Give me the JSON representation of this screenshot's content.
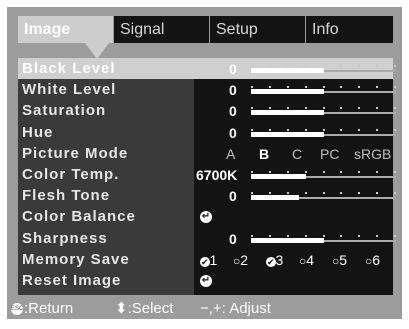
{
  "tabs": [
    {
      "label": "Image",
      "active": true
    },
    {
      "label": "Signal",
      "active": false
    },
    {
      "label": "Setup",
      "active": false
    },
    {
      "label": "Info",
      "active": false
    }
  ],
  "menu": {
    "rows": [
      {
        "label": "Black Level",
        "selected": true,
        "value": "0",
        "level": 0.5
      },
      {
        "label": "White Level",
        "value": "0",
        "level": 0.5
      },
      {
        "label": "Saturation",
        "value": "0",
        "level": 0.5
      },
      {
        "label": "Hue",
        "value": "0",
        "level": 0.5
      },
      {
        "label": "Picture Mode",
        "options": [
          "A",
          "B",
          "C",
          "PC",
          "sRGB"
        ],
        "selected_option": "B"
      },
      {
        "label": "Color Temp.",
        "value": "6700K",
        "level": 0.38
      },
      {
        "label": "Flesh Tone",
        "value": "0",
        "level": 0.33
      },
      {
        "label": "Color Balance",
        "icon": "enter-icon"
      },
      {
        "label": "Sharpness",
        "value": "0",
        "level": 0.5
      },
      {
        "label": "Memory Save",
        "slots": [
          "1",
          "2",
          "3",
          "4",
          "5",
          "6"
        ],
        "saved": [
          "1",
          "3"
        ]
      },
      {
        "label": "Reset Image",
        "icon": "enter-icon"
      }
    ]
  },
  "footer": {
    "return_label": ":Return",
    "select_label": ":Select",
    "adjust_label": "−,+: Adjust",
    "esc_icon": "ESC"
  },
  "colors": {
    "screen_bg": "#9d9c9c",
    "menu_bg": "#131313",
    "label_col_bg": "#3a3a3a",
    "highlight": "#cfcfcf"
  }
}
